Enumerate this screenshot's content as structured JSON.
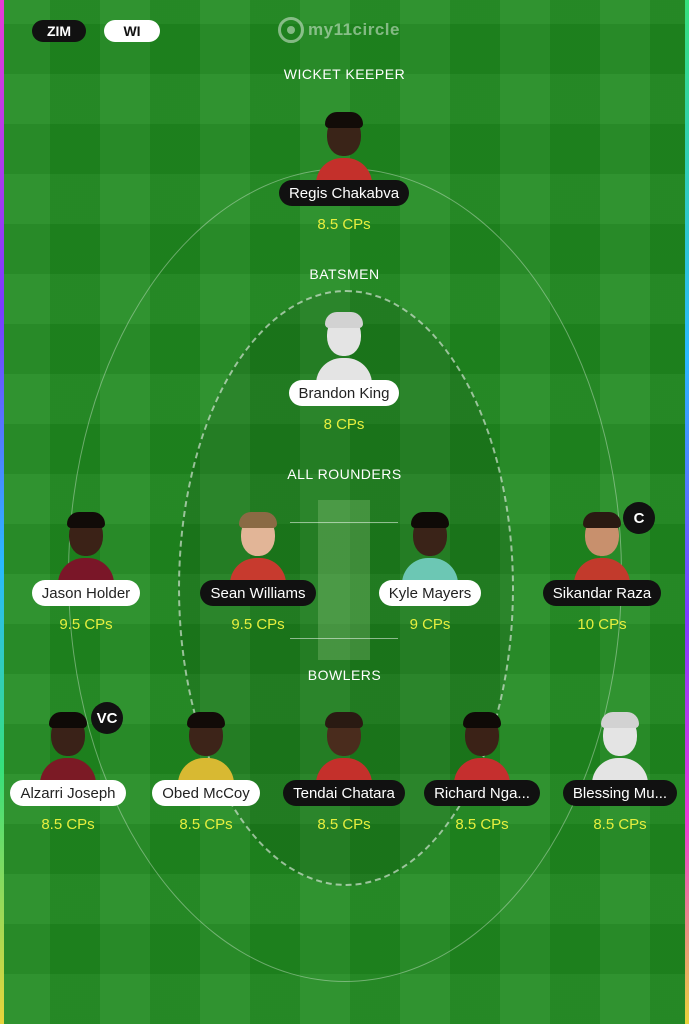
{
  "header": {
    "teams": [
      {
        "label": "ZIM",
        "style": "dark"
      },
      {
        "label": "WI",
        "style": "light"
      }
    ],
    "logo": "my11circle"
  },
  "sections": {
    "wicket_keeper": "WICKET KEEPER",
    "batsmen": "BATSMEN",
    "all_rounders": "ALL ROUNDERS",
    "bowlers": "BOWLERS"
  },
  "players": [
    {
      "name": "Regis Chakabva",
      "cps": "8.5 CPs",
      "team": "ZIM",
      "section": "wicket_keeper"
    },
    {
      "name": "Brandon King",
      "cps": "8 CPs",
      "team": "WI",
      "section": "batsmen"
    },
    {
      "name": "Jason Holder",
      "cps": "9.5 CPs",
      "team": "WI",
      "section": "all_rounders"
    },
    {
      "name": "Sean Williams",
      "cps": "9.5 CPs",
      "team": "ZIM",
      "section": "all_rounders"
    },
    {
      "name": "Kyle Mayers",
      "cps": "9 CPs",
      "team": "WI",
      "section": "all_rounders"
    },
    {
      "name": "Sikandar Raza",
      "cps": "10 CPs",
      "team": "ZIM",
      "section": "all_rounders",
      "badge": "C"
    },
    {
      "name": "Alzarri Joseph",
      "cps": "8.5 CPs",
      "team": "WI",
      "section": "bowlers",
      "badge": "VC"
    },
    {
      "name": "Obed McCoy",
      "cps": "8.5 CPs",
      "team": "WI",
      "section": "bowlers"
    },
    {
      "name": "Tendai Chatara",
      "cps": "8.5 CPs",
      "team": "ZIM",
      "section": "bowlers"
    },
    {
      "name": "Richard Nga...",
      "cps": "8.5 CPs",
      "team": "ZIM",
      "section": "bowlers"
    },
    {
      "name": "Blessing Mu...",
      "cps": "8.5 CPs",
      "team": "ZIM",
      "section": "bowlers"
    }
  ],
  "colors": {
    "field": "#1f8a1f",
    "credits": "#e6ef3f",
    "zim_chip": "#111111",
    "wi_chip": "#ffffff"
  }
}
